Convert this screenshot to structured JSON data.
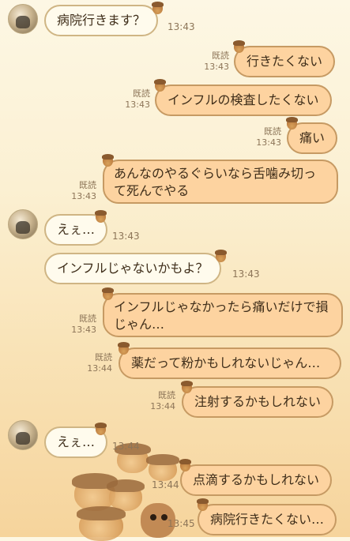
{
  "messages": [
    {
      "dir": "in",
      "text": "病院行きます？",
      "time": "13:43"
    },
    {
      "dir": "out",
      "text": "行きたくない",
      "read": "既読",
      "time": "13:43"
    },
    {
      "dir": "out",
      "text": "インフルの検査したくない",
      "read": "既読",
      "time": "13:43"
    },
    {
      "dir": "out",
      "text": "痛い",
      "read": "既読",
      "time": "13:43"
    },
    {
      "dir": "out",
      "text": "あんなのやるぐらいなら舌噛み切って死んでやる",
      "read": "既読",
      "time": "13:43"
    },
    {
      "dir": "in",
      "text": "えぇ…",
      "time": "13:43"
    },
    {
      "dir": "in",
      "text": "インフルじゃないかもよ？",
      "time": "13:43"
    },
    {
      "dir": "out",
      "text": "インフルじゃなかったら痛いだけで損じゃん…",
      "read": "既読",
      "time": "13:43"
    },
    {
      "dir": "out",
      "text": "薬だって粉かもしれないじゃん…",
      "read": "既読",
      "time": "13:44"
    },
    {
      "dir": "out",
      "text": "注射するかもしれない",
      "read": "既読",
      "time": "13:44"
    },
    {
      "dir": "in",
      "text": "えぇ…",
      "time": "13:44"
    },
    {
      "dir": "out",
      "text": "点滴するかもしれない",
      "time": "13:44"
    },
    {
      "dir": "out",
      "text": "病院行きたくない…",
      "time": "13:45"
    }
  ]
}
